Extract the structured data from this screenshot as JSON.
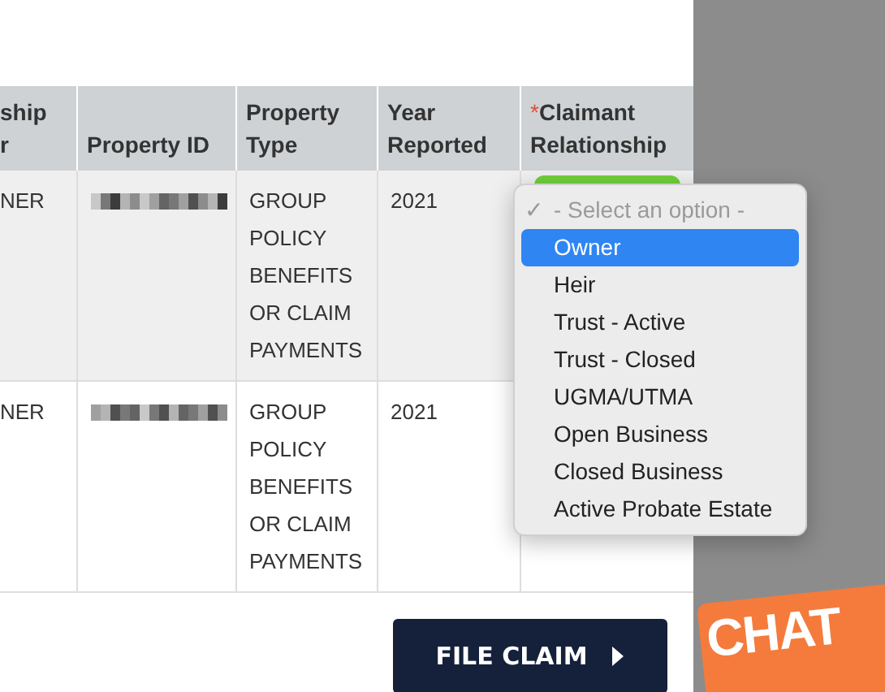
{
  "table": {
    "columns": [
      {
        "lines": [
          "ship",
          "r"
        ]
      },
      {
        "lines": [
          "Property ID"
        ]
      },
      {
        "lines": [
          "Property",
          "Type"
        ]
      },
      {
        "lines": [
          "Year",
          "Reported"
        ]
      },
      {
        "lines": [
          "Claimant",
          "Relationship"
        ],
        "required_mark": "*"
      }
    ],
    "rows": [
      {
        "column_1": "NER",
        "property_type": "GROUP POLICY BENEFITS OR CLAIM PAYMENTS",
        "year_reported": "2021"
      },
      {
        "column_1": "NER",
        "property_type": "GROUP POLICY BENEFITS OR CLAIM PAYMENTS",
        "year_reported": "2021"
      }
    ]
  },
  "dropdown": {
    "check_mark": "✓",
    "options": [
      {
        "label": "- Select an option -",
        "checked": true,
        "selected": false,
        "placeholder": true
      },
      {
        "label": "Owner",
        "checked": false,
        "selected": true,
        "placeholder": false
      },
      {
        "label": "Heir",
        "checked": false,
        "selected": false,
        "placeholder": false
      },
      {
        "label": "Trust - Active",
        "checked": false,
        "selected": false,
        "placeholder": false
      },
      {
        "label": "Trust - Closed",
        "checked": false,
        "selected": false,
        "placeholder": false
      },
      {
        "label": "UGMA/UTMA",
        "checked": false,
        "selected": false,
        "placeholder": false
      },
      {
        "label": "Open Business",
        "checked": false,
        "selected": false,
        "placeholder": false
      },
      {
        "label": "Closed Business",
        "checked": false,
        "selected": false,
        "placeholder": false
      },
      {
        "label": "Active Probate Estate",
        "checked": false,
        "selected": false,
        "placeholder": false
      }
    ]
  },
  "file_claim_button": {
    "label": "FILE CLAIM"
  },
  "chat_badge": {
    "label": "CHAT"
  }
}
